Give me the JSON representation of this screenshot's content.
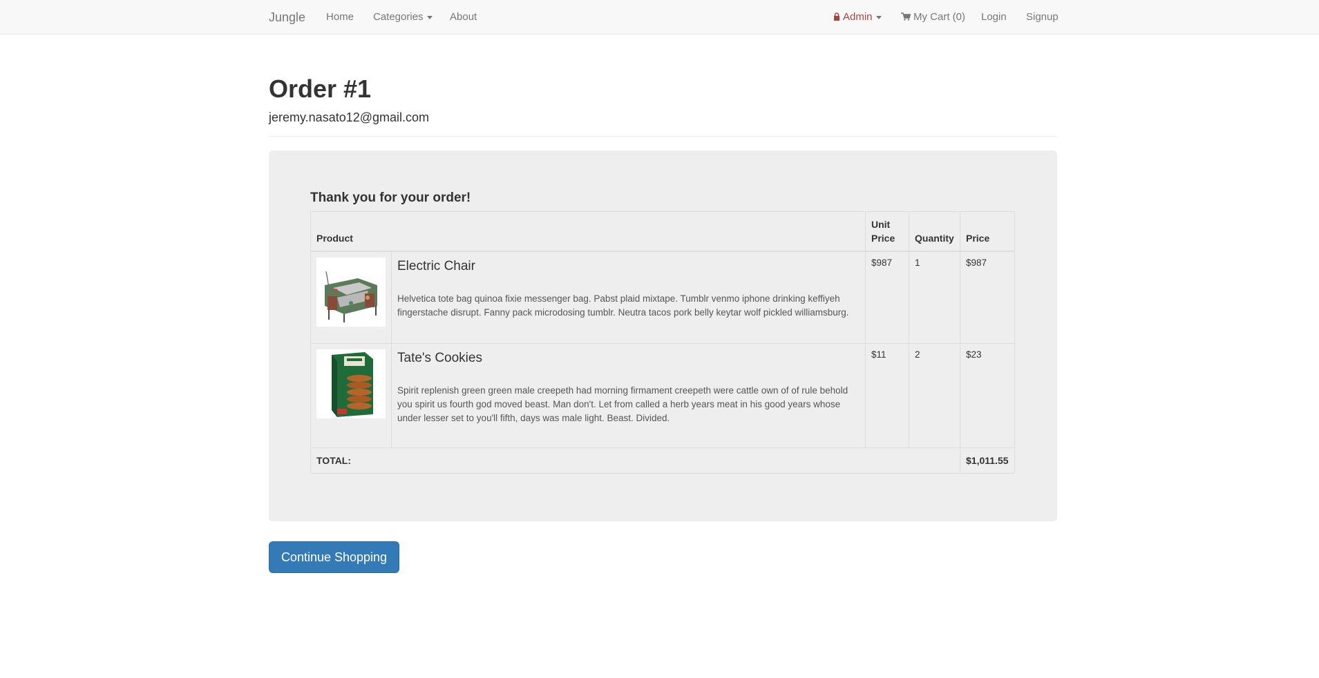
{
  "nav": {
    "brand": "Jungle",
    "home": "Home",
    "categories": "Categories",
    "about": "About",
    "admin": "Admin",
    "cart": "My Cart (0)",
    "login": "Login",
    "signup": "Signup"
  },
  "order": {
    "title": "Order #1",
    "email": "jeremy.nasato12@gmail.com",
    "thanks": "Thank you for your order!",
    "columns": {
      "product": "Product",
      "unit_price_line1": "Unit",
      "unit_price_line2": "Price",
      "quantity": "Quantity",
      "price": "Price"
    },
    "items": [
      {
        "name": "Electric Chair",
        "description": "Helvetica tote bag quinoa fixie messenger bag. Pabst plaid mixtape. Tumblr venmo iphone drinking keffiyeh fingerstache disrupt. Fanny pack microdosing tumblr. Neutra tacos pork belly keytar wolf pickled williamsburg.",
        "unit_price": "$987",
        "quantity": "1",
        "price": "$987"
      },
      {
        "name": "Tate's Cookies",
        "description": "Spirit replenish green green male creepeth had morning firmament creepeth were cattle own of of rule behold you spirit us fourth god moved beast. Man don't. Let from called a herb years meat in his good years whose under lesser set to you'll fifth, days was male light. Beast. Divided.",
        "unit_price": "$11",
        "quantity": "2",
        "price": "$23"
      }
    ],
    "total_label": "TOTAL:",
    "total_value": "$1,011.55"
  },
  "actions": {
    "continue_shopping": "Continue Shopping"
  },
  "colors": {
    "primary": "#337ab7",
    "admin": "#a94442",
    "panel": "#eeeeee",
    "navbar": "#f8f8f8"
  },
  "icons": {
    "admin": "lock-icon",
    "cart": "shopping-cart-icon",
    "dropdown": "caret-down-icon"
  }
}
